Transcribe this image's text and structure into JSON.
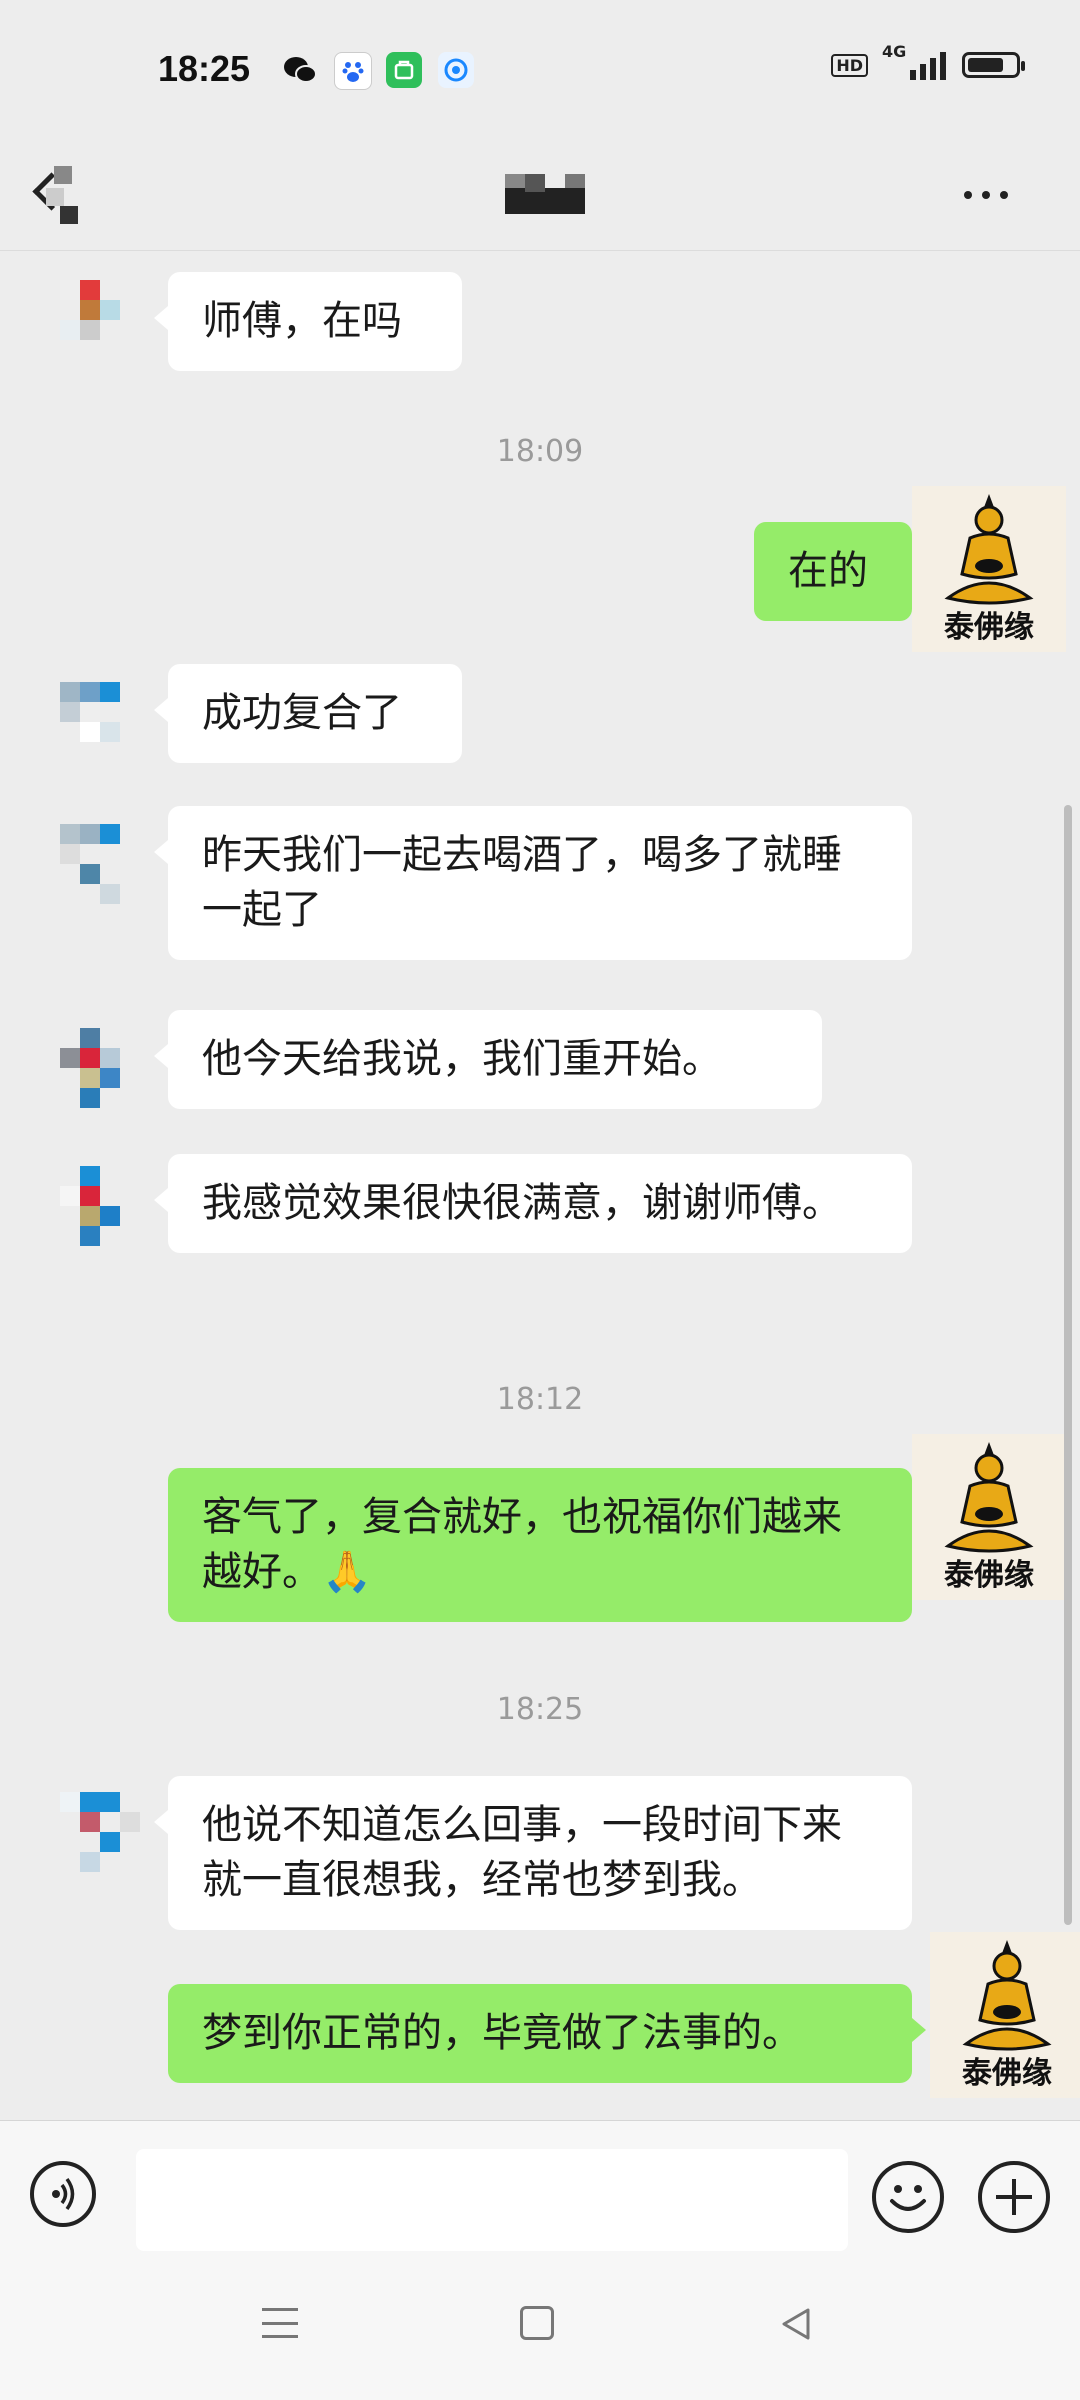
{
  "status_bar": {
    "time": "18:25",
    "network_label": "4G",
    "hd_label": "HD",
    "icons": [
      "wechat-icon",
      "baidu-icon",
      "app-store-icon",
      "browser-icon"
    ],
    "battery_level": 0.75
  },
  "header": {
    "title": "",
    "back_icon": "back-chevron-icon",
    "more_icon": "more-dots-icon"
  },
  "messages": [
    {
      "side": "in",
      "text": "师傅，在吗"
    },
    {
      "side": "time",
      "text": "18:09"
    },
    {
      "side": "out",
      "text": "在的"
    },
    {
      "side": "in",
      "text": "成功复合了"
    },
    {
      "side": "in",
      "text": "昨天我们一起去喝酒了，喝多了就睡一起了"
    },
    {
      "side": "in",
      "text": "他今天给我说，我们重开始。"
    },
    {
      "side": "in",
      "text": "我感觉效果很快很满意，谢谢师傅。"
    },
    {
      "side": "time",
      "text": "18:12"
    },
    {
      "side": "out",
      "text": "客气了，复合就好，也祝福你们越来越好。🙏"
    },
    {
      "side": "time",
      "text": "18:25"
    },
    {
      "side": "in",
      "text": "他说不知道怎么回事，一段时间下来就一直很想我，经常也梦到我。"
    },
    {
      "side": "out",
      "text": "梦到你正常的，毕竟做了法事的。"
    }
  ],
  "self_avatar_caption": "泰佛缘",
  "input_bar": {
    "placeholder": "",
    "voice_icon": "voice-icon",
    "emoji_icon": "emoji-icon",
    "plus_icon": "plus-icon"
  },
  "colors": {
    "outgoing_bubble": "#95ec69",
    "incoming_bubble": "#ffffff",
    "background": "#ededed"
  }
}
